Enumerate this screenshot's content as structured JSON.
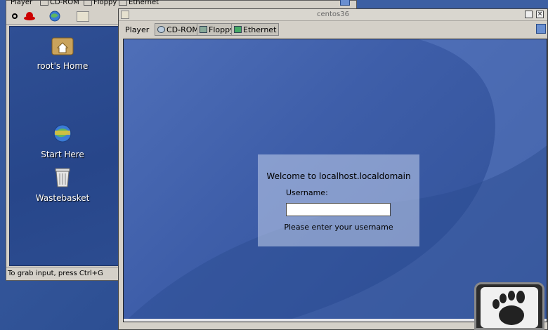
{
  "back_window": {
    "toolbar_tabs": [
      {
        "label": "Player"
      },
      {
        "label": "CD-ROM"
      },
      {
        "label": "Floppy"
      },
      {
        "label": "Ethernet"
      }
    ],
    "desktop_icons": [
      {
        "label": "root's Home",
        "icon": "folder-home-icon"
      },
      {
        "label": "Start Here",
        "icon": "start-here-icon"
      },
      {
        "label": "Wastebasket",
        "icon": "trash-icon"
      }
    ],
    "status": "To grab input, press Ctrl+G"
  },
  "main_window": {
    "title": "centos36",
    "toolbar": {
      "player": "Player",
      "cdrom": "CD-ROM",
      "floppy": "Floppy",
      "ethernet": "Ethernet"
    },
    "login": {
      "welcome": "Welcome to localhost.localdomain",
      "username_label": "Username:",
      "username_value": "",
      "hint": "Please enter your username"
    }
  },
  "colors": {
    "desktop_blue": "#2d4f93",
    "window_gray": "#d4d0c8",
    "login_panel": "#c4d2ec"
  }
}
